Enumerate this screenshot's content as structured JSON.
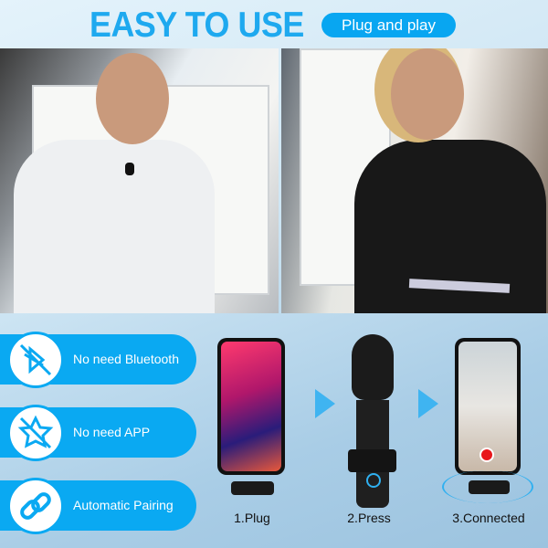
{
  "header": {
    "title": "EASY TO USE",
    "badge": "Plug and play"
  },
  "features": [
    {
      "label": "No need Bluetooth",
      "icon": "bluetooth-off-icon"
    },
    {
      "label": "No need APP",
      "icon": "app-off-icon"
    },
    {
      "label": "Automatic Pairing",
      "icon": "link-icon"
    }
  ],
  "steps": [
    {
      "label": "1.Plug"
    },
    {
      "label": "2.Press"
    },
    {
      "label": "3.Connected"
    }
  ],
  "colors": {
    "accent": "#0aa9f2",
    "title": "#1ea9ef",
    "record": "#e8161b"
  }
}
